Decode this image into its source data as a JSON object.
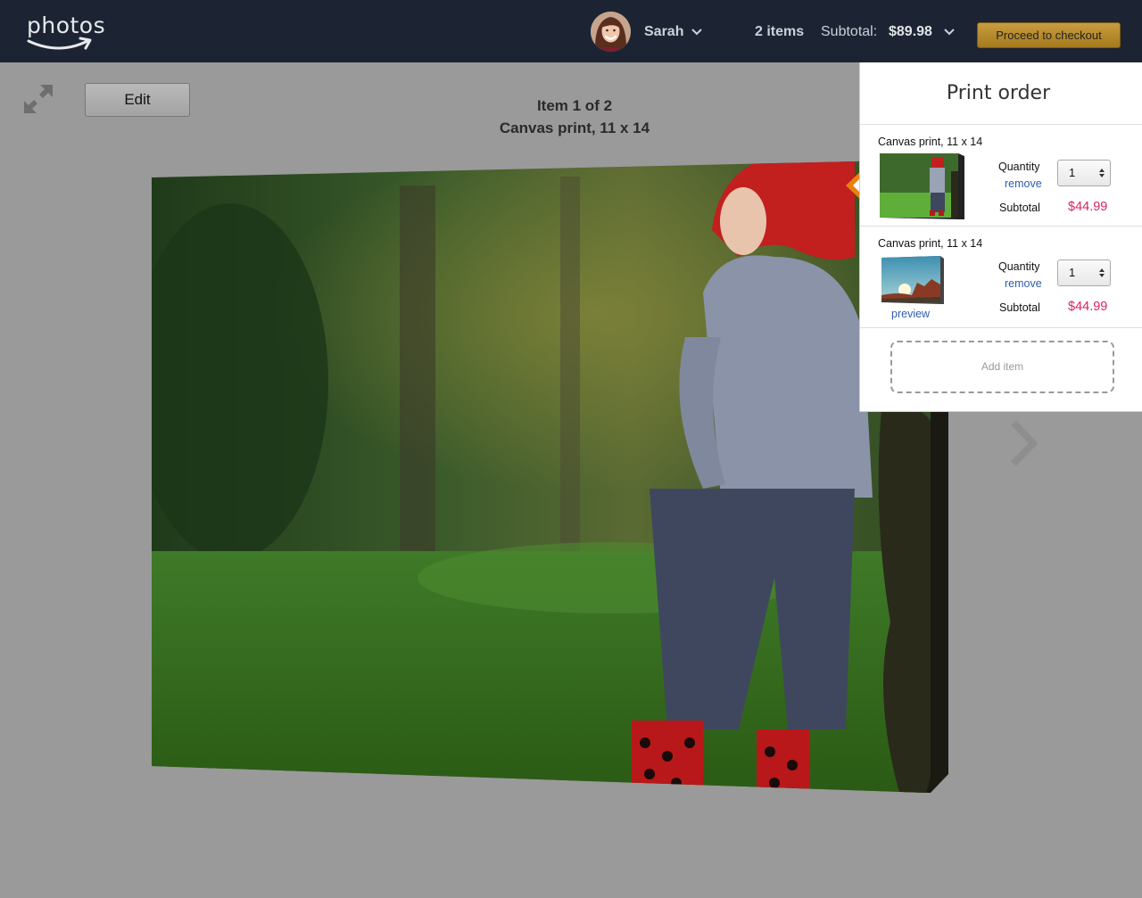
{
  "header": {
    "logo_text": "photos",
    "user_name": "Sarah",
    "items_count": "2 items",
    "subtotal_label": "Subtotal:",
    "subtotal_value": "$89.98",
    "checkout_label": "Proceed to checkout"
  },
  "toolbar": {
    "edit_label": "Edit",
    "item_position": "Item 1 of 2",
    "item_type": "Canvas print, 11 x 14"
  },
  "print_order": {
    "title": "Print order",
    "items": [
      {
        "name": "Canvas print, 11 x 14",
        "quantity_label": "Quantity",
        "quantity_value": "1",
        "remove_label": "remove",
        "subtotal_label": "Subtotal",
        "price": "$44.99",
        "active": true
      },
      {
        "name": "Canvas print, 11 x 14",
        "quantity_label": "Quantity",
        "quantity_value": "1",
        "remove_label": "remove",
        "subtotal_label": "Subtotal",
        "price": "$44.99",
        "preview_label": "preview",
        "active": false
      }
    ],
    "add_item_label": "Add item"
  },
  "colors": {
    "header_bg": "#1c2433",
    "checkout_button": "#b88b2c",
    "price": "#d6245e",
    "link": "#2f5cb1",
    "active_marker": "#e8820c",
    "overlay": "#9a9a9a"
  },
  "icons": {
    "expand": "expand-arrows-icon",
    "user_menu": "chevron-down-icon",
    "cart_menu": "chevron-down-icon",
    "next": "chevron-right-icon",
    "quantity_stepper": "up-down-arrows-icon"
  }
}
